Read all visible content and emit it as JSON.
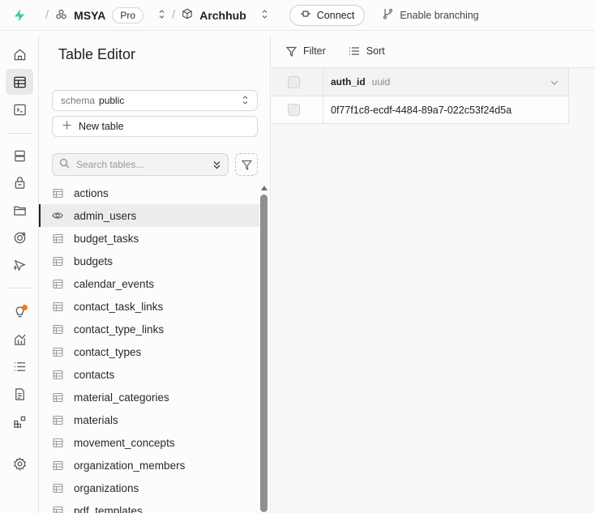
{
  "topbar": {
    "org_name": "MSYA",
    "plan_badge": "Pro",
    "project_name": "Archhub",
    "connect_label": "Connect",
    "branching_label": "Enable branching"
  },
  "rail": {
    "icons": [
      "home-icon",
      "table-editor-icon",
      "sql-editor-icon",
      "database-icon",
      "auth-icon",
      "storage-icon",
      "edge-functions-icon",
      "realtime-icon",
      "advisors-icon",
      "reports-icon",
      "logs-icon",
      "api-docs-icon",
      "integrations-icon",
      "settings-icon"
    ],
    "notification_color": "#f07d12"
  },
  "editor": {
    "title": "Table Editor",
    "schema_label": "schema",
    "schema_value": "public",
    "new_table_label": "New table",
    "search_placeholder": "Search tables...",
    "tables": [
      "actions",
      "admin_users",
      "budget_tasks",
      "budgets",
      "calendar_events",
      "contact_task_links",
      "contact_type_links",
      "contact_types",
      "contacts",
      "material_categories",
      "materials",
      "movement_concepts",
      "organization_members",
      "organizations",
      "pdf_templates"
    ],
    "selected_table": "admin_users"
  },
  "grid": {
    "filter_label": "Filter",
    "sort_label": "Sort",
    "column": {
      "name": "auth_id",
      "type": "uuid"
    },
    "rows": [
      "0f77f1c8-ecdf-4484-89a7-022c53f24d5a"
    ]
  },
  "colors": {
    "brand": "#3ecf8e",
    "accent_dark": "#1f1f1f"
  }
}
